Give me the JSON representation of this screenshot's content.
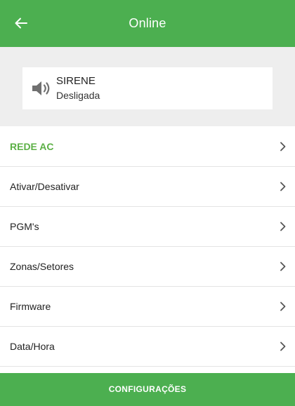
{
  "appbar": {
    "title": "Online",
    "back_icon": "arrow-left-icon"
  },
  "siren": {
    "name": "SIRENE",
    "status": "Desligada",
    "icon": "speaker-icon"
  },
  "menu": {
    "section_label": "REDE AC",
    "items": [
      {
        "label": "Ativar/Desativar"
      },
      {
        "label": "PGM's"
      },
      {
        "label": "Zonas/Setores"
      },
      {
        "label": "Firmware"
      },
      {
        "label": "Data/Hora"
      }
    ]
  },
  "footer": {
    "button_label": "CONFIGURAÇÕES"
  },
  "colors": {
    "primary": "#4caf50",
    "section_text": "#5cb046",
    "status_background": "#eeeeee"
  }
}
